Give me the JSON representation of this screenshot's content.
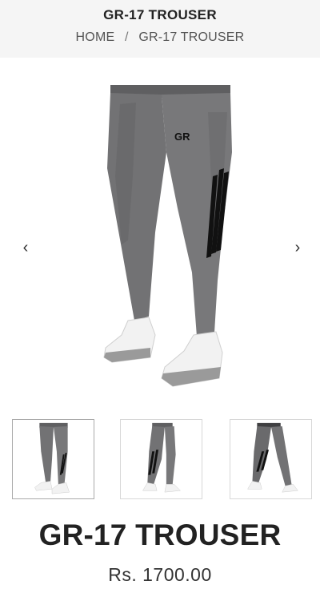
{
  "header": {
    "title": "GR-17 TROUSER",
    "breadcrumb": {
      "home": "HOME",
      "separator": "/",
      "current": "GR-17 TROUSER"
    }
  },
  "gallery": {
    "prev_icon": "chevron-left-icon",
    "next_icon": "chevron-right-icon",
    "prev_glyph": "‹",
    "next_glyph": "›",
    "logo_text": "GR",
    "thumbnails": [
      {
        "name": "front-view",
        "active": true
      },
      {
        "name": "side-view",
        "active": false
      },
      {
        "name": "back-side-view",
        "active": false
      }
    ]
  },
  "product": {
    "name": "GR-17 TROUSER",
    "price": "Rs. 1700.00"
  },
  "colors": {
    "header_bg": "#f5f5f5",
    "trouser_grey": "#6e6e70",
    "stripe_black": "#111111",
    "shoe_white": "#f2f2f2"
  }
}
